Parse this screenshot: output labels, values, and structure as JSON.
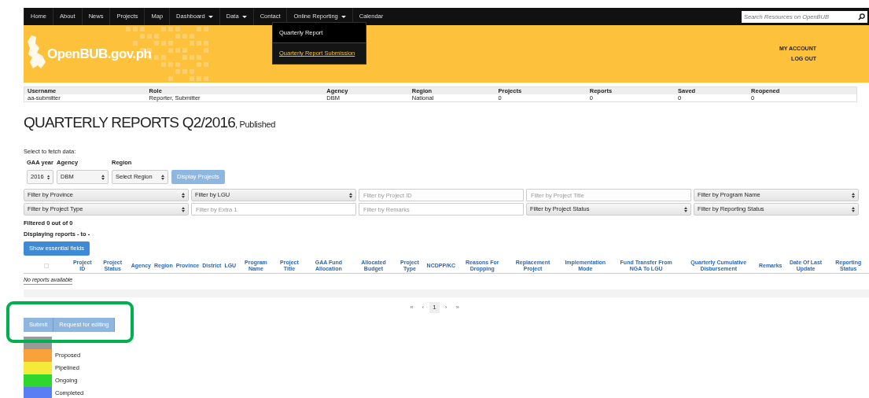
{
  "nav": {
    "items": [
      {
        "label": "Home",
        "dropdown": false
      },
      {
        "label": "About",
        "dropdown": false
      },
      {
        "label": "News",
        "dropdown": false
      },
      {
        "label": "Projects",
        "dropdown": false
      },
      {
        "label": "Map",
        "dropdown": false
      },
      {
        "label": "Dashboard",
        "dropdown": true
      },
      {
        "label": "Data",
        "dropdown": true
      },
      {
        "label": "Contact",
        "dropdown": false
      },
      {
        "label": "Online Reporting",
        "dropdown": true
      },
      {
        "label": "Calendar",
        "dropdown": false
      }
    ],
    "menu": [
      {
        "label": "Quarterly Report",
        "selected": false
      },
      {
        "label": "Quarterly Report Submission",
        "selected": true
      }
    ],
    "search": {
      "placeholder": "Search Resources on OpenBUB"
    }
  },
  "header": {
    "logo_text": "OpenBUB.gov.ph",
    "links": [
      "MY ACCOUNT",
      "LOG OUT"
    ]
  },
  "user_table": {
    "columns": [
      "Username",
      "Role",
      "Agency",
      "Region",
      "Projects",
      "Reports",
      "Saved",
      "Reopened"
    ],
    "rows": [
      [
        "aa-submitter",
        "Reporter, Submitter",
        "DBM",
        "National",
        "0",
        "0",
        "0",
        "0"
      ]
    ]
  },
  "title": "QUARTERLY REPORTS Q2/2016",
  "subtitle": ", Published",
  "fetch": {
    "prompt": "Select to fetch data:",
    "fields": [
      {
        "label": "GAA year",
        "value": "2016"
      },
      {
        "label": "Agency",
        "value": "DBM"
      },
      {
        "label": "Region",
        "value": "Select Region"
      }
    ],
    "button": "Display Projects"
  },
  "filters": [
    {
      "kind": "select",
      "text": "Filter by Province"
    },
    {
      "kind": "select",
      "text": "Filter by LGU"
    },
    {
      "kind": "input",
      "placeholder": "Filter by Project ID"
    },
    {
      "kind": "input",
      "placeholder": "Filter by Project Title"
    },
    {
      "kind": "select",
      "text": "Filter by Program Name"
    },
    {
      "kind": "select",
      "text": "Filter by Project Type"
    },
    {
      "kind": "input",
      "placeholder": "Filter by Extra 1"
    },
    {
      "kind": "input",
      "placeholder": "Filter by Remarks"
    },
    {
      "kind": "select",
      "text": "Filter by Project Status"
    },
    {
      "kind": "select",
      "text": "Filter by Reporting Status"
    }
  ],
  "filtered_text": "Filtered 0 out of 0",
  "displaying_text": "Displaying reports - to -",
  "essential_button": "Show essential fields",
  "reports_table": {
    "select_all_checked": false,
    "columns": [
      "Project ID",
      "Project Status",
      "Agency",
      "Region",
      "Province",
      "District",
      "LGU",
      "Program Name",
      "Project Title",
      "GAA Fund Allocation",
      "Allocated Budget",
      "Project Type",
      "NCDPP/KC",
      "Reasons For Dropping",
      "Replacement Project",
      "Implementation Mode",
      "Fund Transfer From NGA To LGU",
      "Quarterly Cumulative Disbursement",
      "Remarks",
      "Date Of Last Update",
      "Reporting Status"
    ],
    "empty_text": "No reports available"
  },
  "pagination": [
    {
      "label": "«",
      "selected": false
    },
    {
      "label": "‹",
      "selected": false
    },
    {
      "label": "1",
      "selected": true
    },
    {
      "label": "›",
      "selected": false
    },
    {
      "label": "»",
      "selected": false
    }
  ],
  "actions": [
    {
      "label": "Submit",
      "disabled": true
    },
    {
      "label": "Request for editing",
      "disabled": true
    }
  ],
  "annotation": {
    "kind": "highlight-frame"
  },
  "legend": [
    {
      "color": "#9a9a9a"
    },
    {
      "label": "Proposed",
      "color": "#f9a23a"
    },
    {
      "label": "Pipelined",
      "color": "#f4ea3a"
    },
    {
      "label": "Ongoing",
      "color": "#2ed62e"
    },
    {
      "label": "Completed",
      "color": "#5b7ef5"
    }
  ]
}
